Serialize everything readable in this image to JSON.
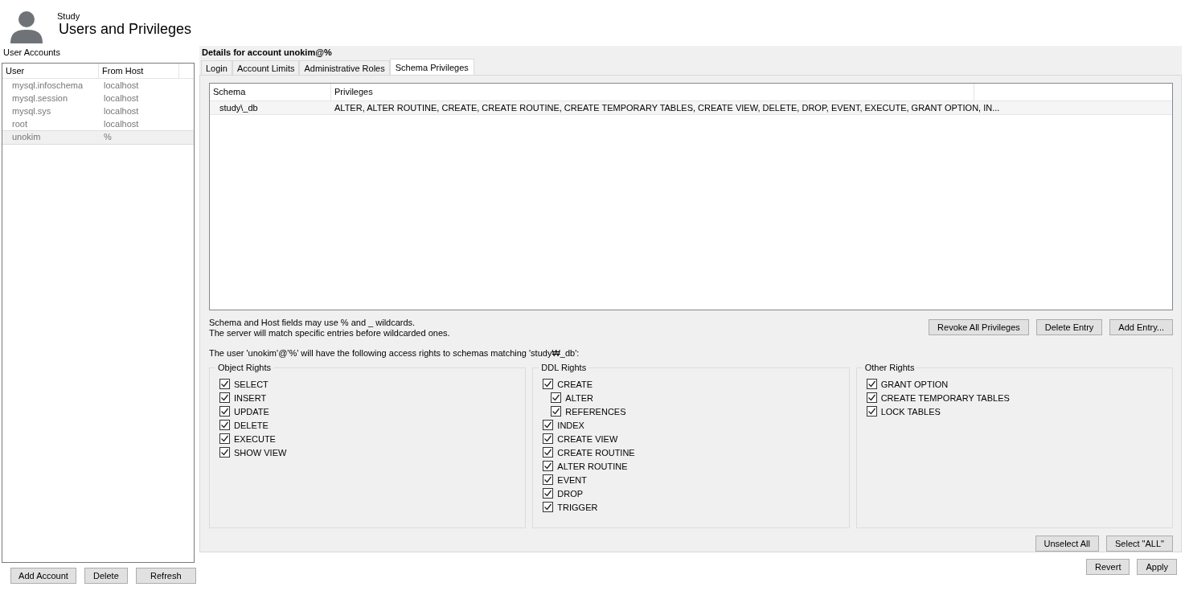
{
  "header": {
    "subtitle": "Study",
    "title": "Users and Privileges"
  },
  "accounts": {
    "label": "User Accounts",
    "columns": [
      "User",
      "From Host"
    ],
    "rows": [
      {
        "user": "mysql.infoschema",
        "host": "localhost",
        "selected": false
      },
      {
        "user": "mysql.session",
        "host": "localhost",
        "selected": false
      },
      {
        "user": "mysql.sys",
        "host": "localhost",
        "selected": false
      },
      {
        "user": "root",
        "host": "localhost",
        "selected": false
      },
      {
        "user": "unokim",
        "host": "%",
        "selected": true
      }
    ],
    "buttons": [
      "Add Account",
      "Delete",
      "Refresh"
    ]
  },
  "details": {
    "title": "Details for account unokim@%",
    "tabs": [
      {
        "label": "Login",
        "selected": false
      },
      {
        "label": "Account Limits",
        "selected": false
      },
      {
        "label": "Administrative Roles",
        "selected": false
      },
      {
        "label": "Schema Privileges",
        "selected": true
      }
    ],
    "grid": {
      "columns": [
        "Schema",
        "Privileges"
      ],
      "rows": [
        {
          "schema": "study\\_db",
          "privileges": "ALTER, ALTER ROUTINE, CREATE, CREATE ROUTINE, CREATE TEMPORARY TABLES, CREATE VIEW, DELETE, DROP, EVENT, EXECUTE, GRANT OPTION, IN..."
        }
      ]
    },
    "hint_lines": [
      "Schema and Host fields may use % and _ wildcards.",
      "The server will match specific entries before wildcarded ones."
    ],
    "entry_buttons": [
      "Revoke All Privileges",
      "Delete Entry",
      "Add Entry..."
    ],
    "access_note": "The user 'unokim'@'%' will have the following access rights to schemas matching 'study₩_db':",
    "groups": [
      {
        "title": "Object Rights",
        "items": [
          {
            "label": "SELECT",
            "checked": true
          },
          {
            "label": "INSERT",
            "checked": true
          },
          {
            "label": "UPDATE",
            "checked": true
          },
          {
            "label": "DELETE",
            "checked": true
          },
          {
            "label": "EXECUTE",
            "checked": true
          },
          {
            "label": "SHOW VIEW",
            "checked": true
          }
        ]
      },
      {
        "title": "DDL Rights",
        "items": [
          {
            "label": "CREATE",
            "checked": true,
            "children": [
              {
                "label": "ALTER",
                "checked": true
              },
              {
                "label": "REFERENCES",
                "checked": true
              }
            ]
          },
          {
            "label": "INDEX",
            "checked": true
          },
          {
            "label": "CREATE VIEW",
            "checked": true
          },
          {
            "label": "CREATE ROUTINE",
            "checked": true
          },
          {
            "label": "ALTER ROUTINE",
            "checked": true
          },
          {
            "label": "EVENT",
            "checked": true
          },
          {
            "label": "DROP",
            "checked": true
          },
          {
            "label": "TRIGGER",
            "checked": true
          }
        ]
      },
      {
        "title": "Other Rights",
        "items": [
          {
            "label": "GRANT OPTION",
            "checked": true
          },
          {
            "label": "CREATE TEMPORARY TABLES",
            "checked": true
          },
          {
            "label": "LOCK TABLES",
            "checked": true
          }
        ]
      }
    ],
    "select_buttons": [
      "Unselect All",
      "Select \"ALL\""
    ]
  },
  "footer_buttons": [
    "Revert",
    "Apply"
  ]
}
